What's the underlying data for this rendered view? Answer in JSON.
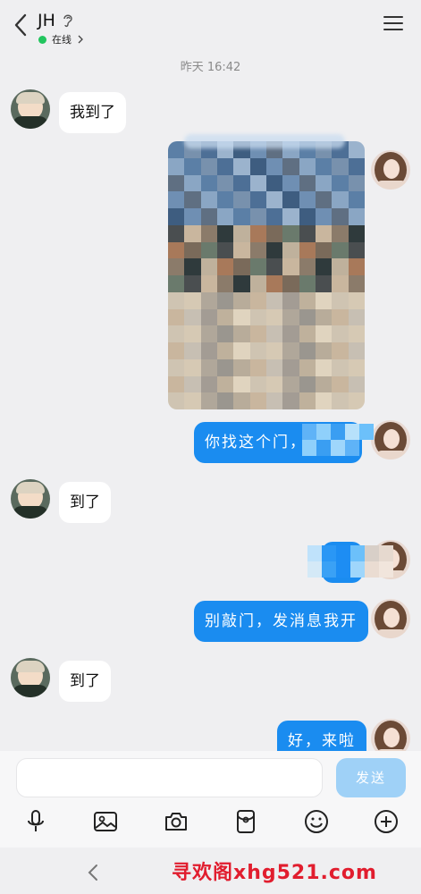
{
  "header": {
    "title": "JH",
    "status": "在线",
    "icons": {
      "back": "back-arrow-icon",
      "ear": "ear-icon",
      "menu": "menu-icon",
      "chevron": "chevron-right-icon"
    },
    "status_color": "#22c55e"
  },
  "conversation": {
    "timestamp": "昨天 16:42",
    "messages": [
      {
        "side": "left",
        "type": "text",
        "text": "我到了"
      },
      {
        "side": "right",
        "type": "image",
        "text": ""
      },
      {
        "side": "right",
        "type": "text",
        "text": "你找这个门，"
      },
      {
        "side": "left",
        "type": "text",
        "text": "到了"
      },
      {
        "side": "right",
        "type": "text",
        "text": ""
      },
      {
        "side": "right",
        "type": "text",
        "text": "别敲门，发消息我开"
      },
      {
        "side": "left",
        "type": "text",
        "text": "到了"
      },
      {
        "side": "right",
        "type": "text",
        "text": "好，来啦"
      }
    ]
  },
  "composer": {
    "input_value": "",
    "send_label": "发送",
    "tools": [
      "microphone-icon",
      "image-icon",
      "camera-icon",
      "red-packet-icon",
      "emoji-icon",
      "plus-icon"
    ]
  },
  "navbar": {
    "back_icon": "nav-back-icon",
    "watermark": "寻欢阁xhg521.com"
  },
  "colors": {
    "accent": "#1a8cf0",
    "send_disabled": "#9fd1f7",
    "background": "#efeff1",
    "watermark": "#e11d2e"
  }
}
